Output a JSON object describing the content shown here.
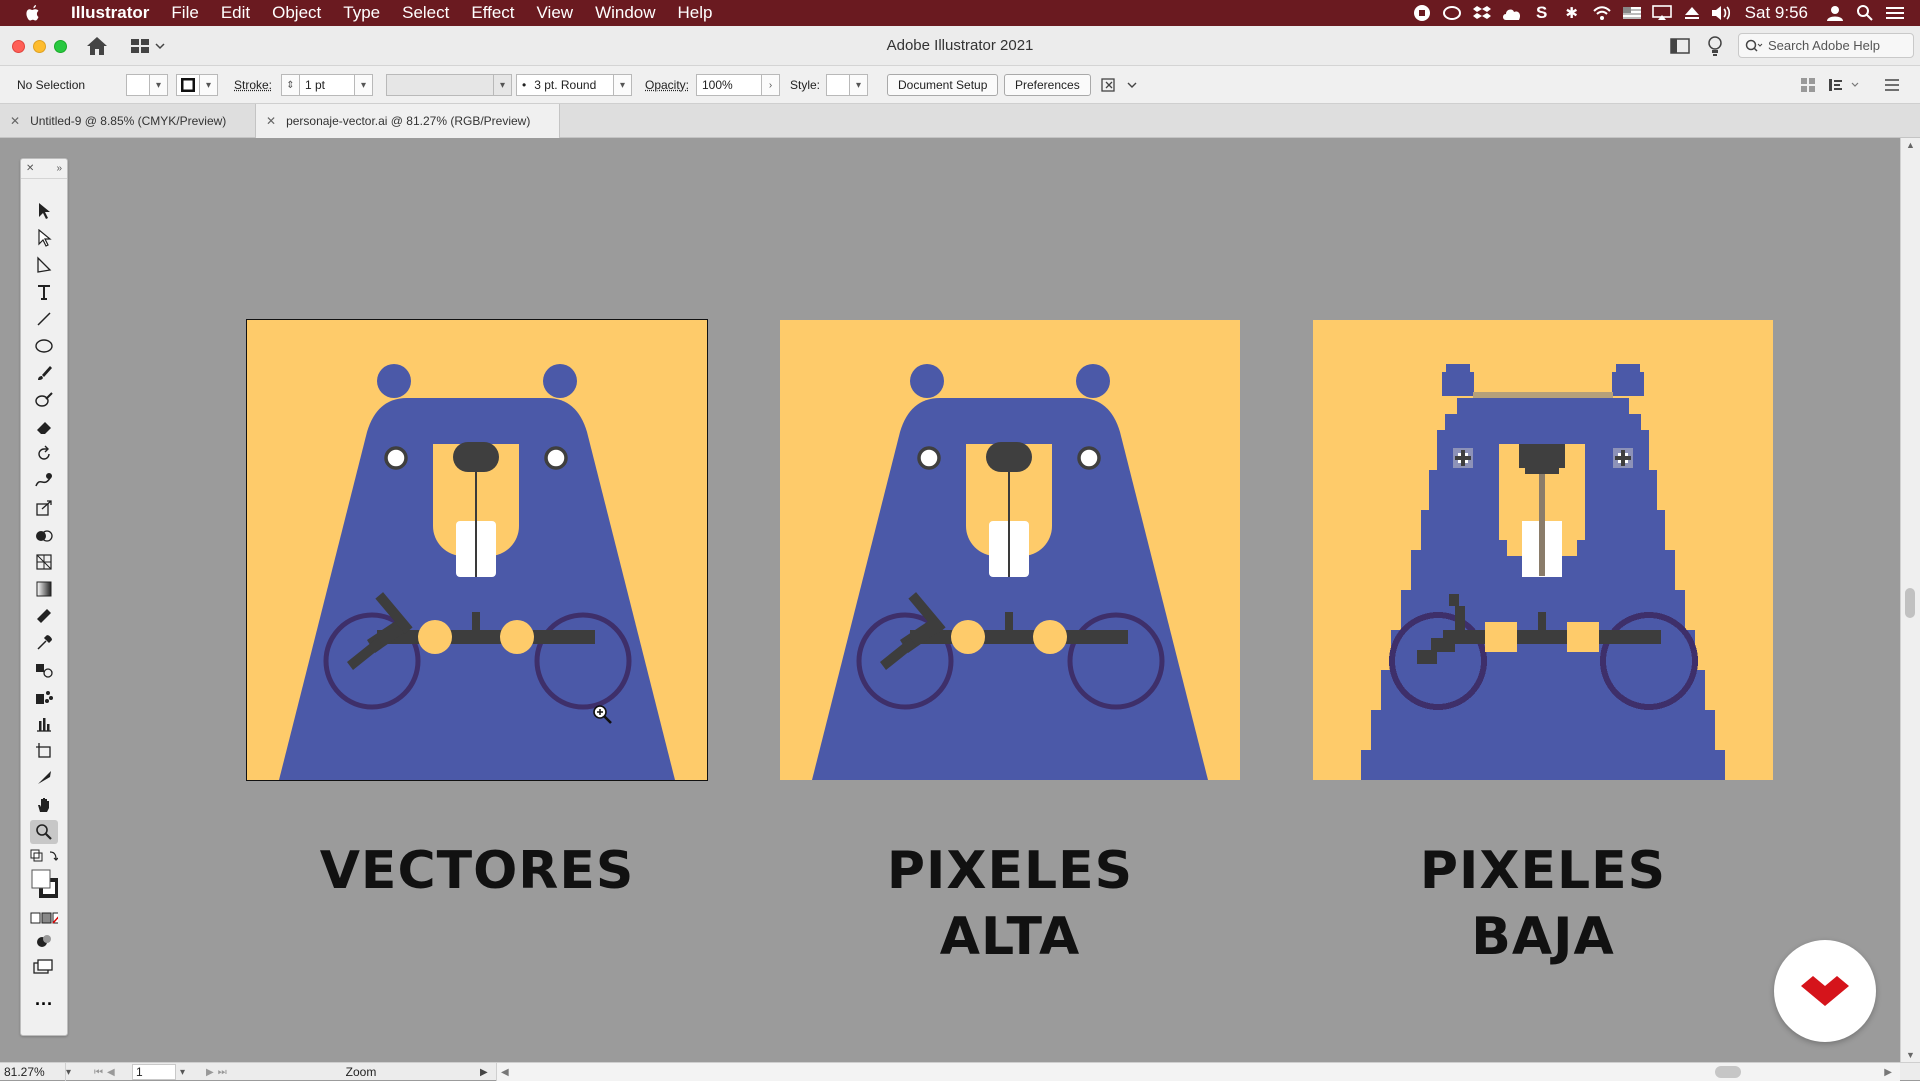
{
  "menubar": {
    "app_name": "Illustrator",
    "items": [
      "File",
      "Edit",
      "Object",
      "Type",
      "Select",
      "Effect",
      "View",
      "Window",
      "Help"
    ],
    "clock": "Sat 9:56"
  },
  "titlebar": {
    "title": "Adobe Illustrator 2021",
    "search_placeholder": "Search Adobe Help"
  },
  "controlbar": {
    "selection": "No Selection",
    "stroke_label": "Stroke:",
    "stroke_value": "1 pt",
    "brush": "3 pt. Round",
    "opacity_label": "Opacity:",
    "opacity_value": "100%",
    "style_label": "Style:",
    "document_setup": "Document Setup",
    "preferences": "Preferences"
  },
  "tabs": [
    {
      "label": "Untitled-9 @ 8.85% (CMYK/Preview)",
      "active": false
    },
    {
      "label": "personaje-vector.ai @ 81.27% (RGB/Preview)",
      "active": true
    }
  ],
  "artboards": [
    {
      "label_line1": "VECTORES",
      "label_line2": "",
      "render": "vector",
      "selected": true
    },
    {
      "label_line1": "PIXELES",
      "label_line2": "ALTA",
      "render": "pixel-high",
      "selected": false
    },
    {
      "label_line1": "PIXELES",
      "label_line2": "BAJA",
      "render": "pixel-low",
      "selected": false
    }
  ],
  "colors": {
    "background": "#fecb6a",
    "body": "#4b59a8",
    "muzzle": "#fecb6a",
    "nose": "#3f3f3f",
    "branch": "#3d3d3d",
    "wheels": "#3e2f6a",
    "canvas": "#9b9b9b",
    "menubar": "#6a1a20",
    "logo": "#d5141b"
  },
  "statusbar": {
    "zoom": "81.27%",
    "artboard_number": "1",
    "tool_name": "Zoom"
  },
  "icons": [
    "apple-icon",
    "home-icon",
    "workspace-icon",
    "search-icon",
    "lightbulb-icon",
    "zoom-tool-icon",
    "selection-tool-icon",
    "type-tool-icon",
    "hand-tool-icon"
  ]
}
